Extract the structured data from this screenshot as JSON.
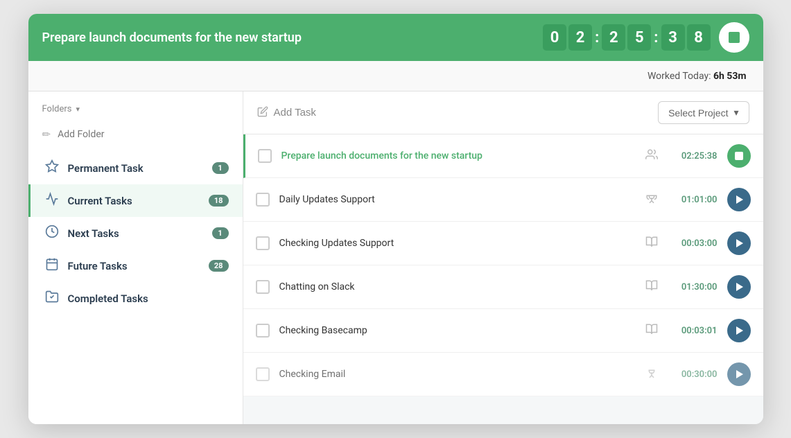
{
  "header": {
    "title": "Prepare launch documents for the new startup",
    "timer": {
      "digits": [
        "0",
        "2",
        "2",
        "5",
        "3",
        "8"
      ],
      "display": "02:25:38"
    },
    "stop_label": "Stop"
  },
  "subheader": {
    "worked_today_label": "Worked Today:",
    "worked_today_value": "6h 53m"
  },
  "sidebar": {
    "folders_label": "Folders",
    "add_folder_label": "Add Folder",
    "items": [
      {
        "label": "Permanent Task",
        "badge": "1",
        "icon": "⚑",
        "active": false
      },
      {
        "label": "Current Tasks",
        "badge": "18",
        "icon": "📥",
        "active": true
      },
      {
        "label": "Next Tasks",
        "badge": "1",
        "icon": "🕐",
        "active": false
      },
      {
        "label": "Future Tasks",
        "badge": "28",
        "icon": "📅",
        "active": false
      },
      {
        "label": "Completed Tasks",
        "badge": "",
        "icon": "✓",
        "active": false
      }
    ]
  },
  "toolbar": {
    "add_task_label": "Add Task",
    "select_project_label": "Select Project"
  },
  "tasks": [
    {
      "name": "Prepare launch documents for the new startup",
      "time": "02:25:38",
      "icon": "people",
      "running": true
    },
    {
      "name": "Daily Updates Support",
      "time": "01:01:00",
      "icon": "trophy",
      "running": false
    },
    {
      "name": "Checking Updates Support",
      "time": "00:03:00",
      "icon": "book",
      "running": false
    },
    {
      "name": "Chatting on Slack",
      "time": "01:30:00",
      "icon": "book",
      "running": false
    },
    {
      "name": "Checking Basecamp",
      "time": "00:03:01",
      "icon": "book",
      "running": false
    },
    {
      "name": "Checking Email",
      "time": "00:30:00",
      "icon": "trophy",
      "running": false
    }
  ]
}
